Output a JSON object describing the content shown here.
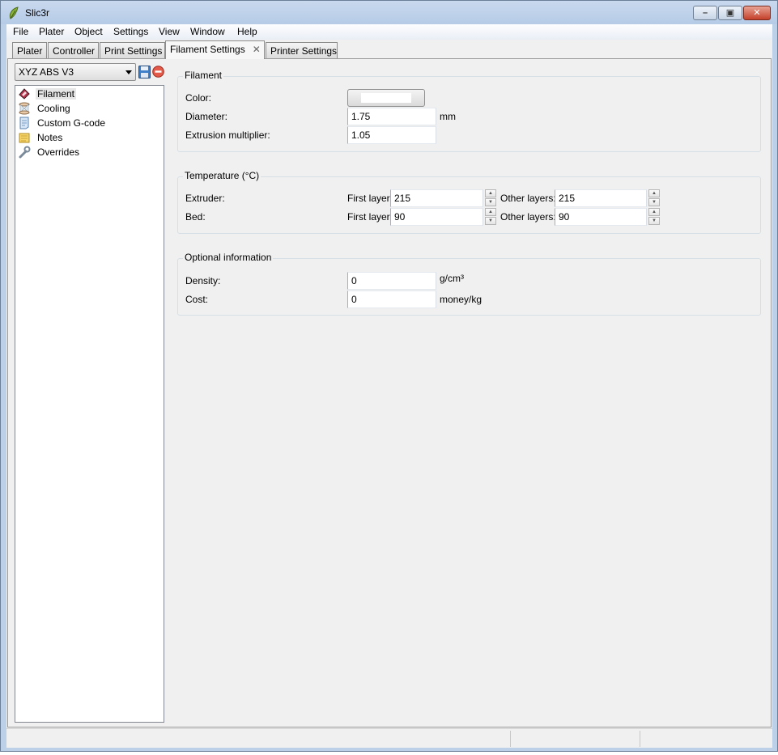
{
  "window": {
    "title": "Slic3r"
  },
  "menu": [
    "File",
    "Plater",
    "Object",
    "Settings",
    "View",
    "Window",
    "Help"
  ],
  "tabs": [
    {
      "label": "Plater"
    },
    {
      "label": "Controller"
    },
    {
      "label": "Print Settings"
    },
    {
      "label": "Filament Settings",
      "close": "✕"
    },
    {
      "label": "Printer Settings"
    }
  ],
  "preset": {
    "selected": "XYZ ABS V3"
  },
  "sidebar": {
    "items": [
      {
        "label": "Filament",
        "icon": "filament-spool-icon"
      },
      {
        "label": "Cooling",
        "icon": "hourglass-icon"
      },
      {
        "label": "Custom G-code",
        "icon": "script-icon"
      },
      {
        "label": "Notes",
        "icon": "note-icon"
      },
      {
        "label": "Overrides",
        "icon": "wrench-icon"
      }
    ]
  },
  "filament": {
    "title": "Filament",
    "color_label": "Color:",
    "color_value": "#ffffff",
    "diameter_label": "Diameter:",
    "diameter_value": "1.75",
    "diameter_unit": "mm",
    "extrusion_label": "Extrusion multiplier:",
    "extrusion_value": "1.05"
  },
  "temperature": {
    "title": "Temperature (°C)",
    "extruder_label": "Extruder:",
    "bed_label": "Bed:",
    "first_layer_label": "First layer:",
    "other_layers_label": "Other layers:",
    "extruder_first": "215",
    "extruder_other": "215",
    "bed_first": "90",
    "bed_other": "90"
  },
  "optional": {
    "title": "Optional information",
    "density_label": "Density:",
    "density_value": "0",
    "density_unit": "g/cm³",
    "cost_label": "Cost:",
    "cost_value": "0",
    "cost_unit": "money/kg"
  },
  "colors": {
    "window_frame": "#bcd0e8",
    "close_button": "#c5402a",
    "panel_bg": "#f0f0f0"
  }
}
